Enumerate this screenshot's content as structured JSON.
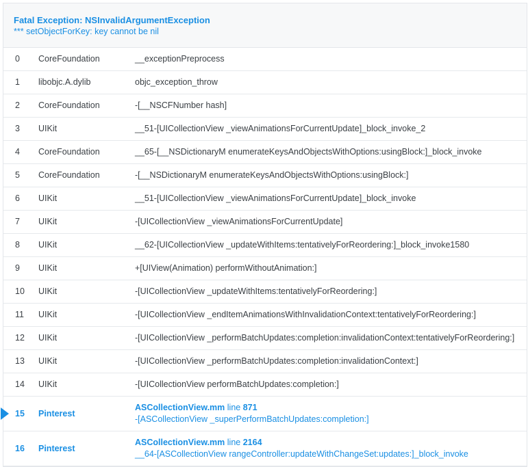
{
  "exception": {
    "title": "Fatal Exception: NSInvalidArgumentException",
    "message": "*** setObjectForKey: key cannot be nil"
  },
  "frames": [
    {
      "num": "0",
      "lib": "CoreFoundation",
      "symbol": "__exceptionPreprocess"
    },
    {
      "num": "1",
      "lib": "libobjc.A.dylib",
      "symbol": "objc_exception_throw"
    },
    {
      "num": "2",
      "lib": "CoreFoundation",
      "symbol": "-[__NSCFNumber hash]"
    },
    {
      "num": "3",
      "lib": "UIKit",
      "symbol": "__51-[UICollectionView _viewAnimationsForCurrentUpdate]_block_invoke_2"
    },
    {
      "num": "4",
      "lib": "CoreFoundation",
      "symbol": "__65-[__NSDictionaryM enumerateKeysAndObjectsWithOptions:usingBlock:]_block_invoke"
    },
    {
      "num": "5",
      "lib": "CoreFoundation",
      "symbol": "-[__NSDictionaryM enumerateKeysAndObjectsWithOptions:usingBlock:]"
    },
    {
      "num": "6",
      "lib": "UIKit",
      "symbol": "__51-[UICollectionView _viewAnimationsForCurrentUpdate]_block_invoke"
    },
    {
      "num": "7",
      "lib": "UIKit",
      "symbol": "-[UICollectionView _viewAnimationsForCurrentUpdate]"
    },
    {
      "num": "8",
      "lib": "UIKit",
      "symbol": "__62-[UICollectionView _updateWithItems:tentativelyForReordering:]_block_invoke1580"
    },
    {
      "num": "9",
      "lib": "UIKit",
      "symbol": "+[UIView(Animation) performWithoutAnimation:]"
    },
    {
      "num": "10",
      "lib": "UIKit",
      "symbol": "-[UICollectionView _updateWithItems:tentativelyForReordering:]"
    },
    {
      "num": "11",
      "lib": "UIKit",
      "symbol": "-[UICollectionView _endItemAnimationsWithInvalidationContext:tentativelyForReordering:]"
    },
    {
      "num": "12",
      "lib": "UIKit",
      "symbol": "-[UICollectionView _performBatchUpdates:completion:invalidationContext:tentativelyForReordering:]"
    },
    {
      "num": "13",
      "lib": "UIKit",
      "symbol": "-[UICollectionView _performBatchUpdates:completion:invalidationContext:]"
    },
    {
      "num": "14",
      "lib": "UIKit",
      "symbol": "-[UICollectionView performBatchUpdates:completion:]"
    }
  ],
  "app_frames": [
    {
      "num": "15",
      "lib": "Pinterest",
      "file": "ASCollectionView.mm",
      "line_word": "line",
      "line": "871",
      "symbol": "-[ASCollectionView _superPerformBatchUpdates:completion:]"
    },
    {
      "num": "16",
      "lib": "Pinterest",
      "file": "ASCollectionView.mm",
      "line_word": "line",
      "line": "2164",
      "symbol": "__64-[ASCollectionView rangeController:updateWithChangeSet:updates:]_block_invoke"
    }
  ]
}
